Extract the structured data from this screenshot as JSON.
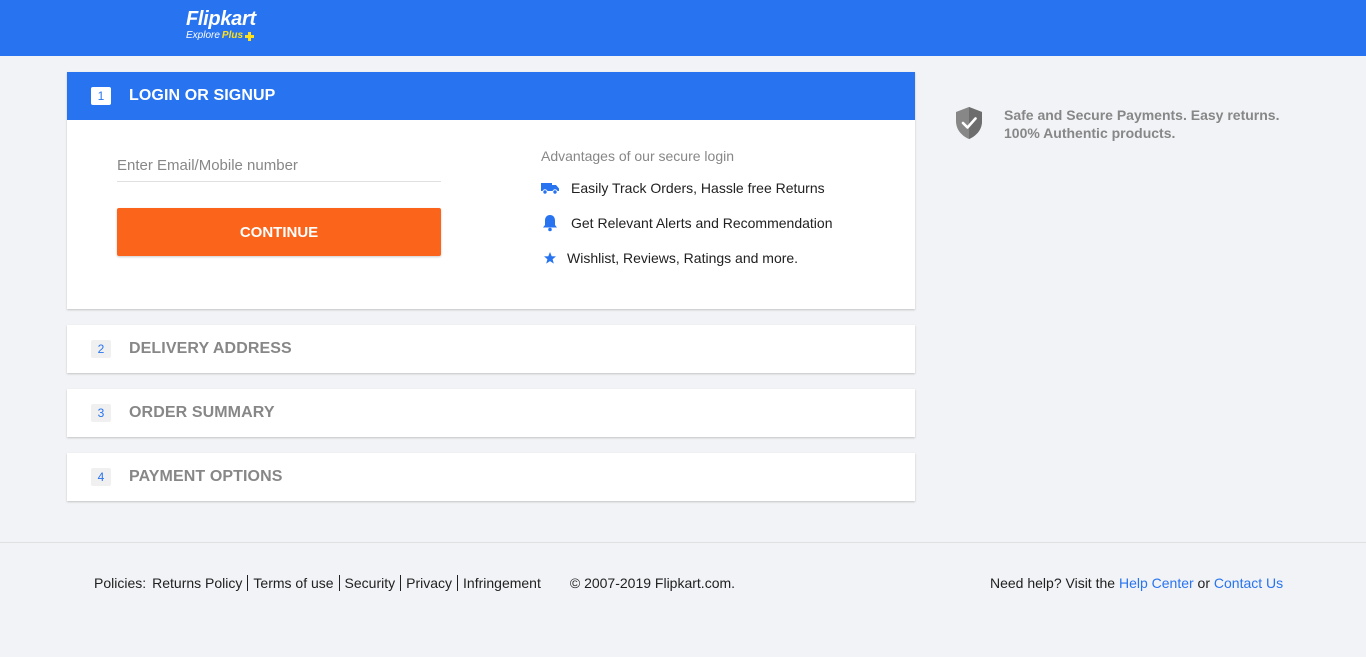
{
  "header": {
    "logo_text": "Flipkart",
    "logo_sub_prefix": "Explore",
    "logo_sub_plus": "Plus",
    "bg_color": "#2874f0"
  },
  "steps": [
    {
      "number": "1",
      "title": "LOGIN OR SIGNUP"
    },
    {
      "number": "2",
      "title": "DELIVERY ADDRESS"
    },
    {
      "number": "3",
      "title": "ORDER SUMMARY"
    },
    {
      "number": "4",
      "title": "PAYMENT OPTIONS"
    }
  ],
  "login": {
    "input_placeholder": "Enter Email/Mobile number",
    "input_value": "",
    "continue_label": "CONTINUE",
    "button_color": "#fb641b",
    "advantages_title": "Advantages of our secure login",
    "advantages": [
      {
        "icon": "truck-icon",
        "text": "Easily Track Orders, Hassle free Returns"
      },
      {
        "icon": "bell-icon",
        "text": "Get Relevant Alerts and Recommendation"
      },
      {
        "icon": "star-icon",
        "text": "Wishlist, Reviews, Ratings and more."
      }
    ]
  },
  "secure_note": {
    "icon": "shield-check-icon",
    "line1": "Safe and Secure Payments. Easy returns.",
    "line2": "100% Authentic products."
  },
  "footer": {
    "policies_label": "Policies:",
    "links": [
      "Returns Policy",
      "Terms of use",
      "Security",
      "Privacy",
      "Infringement"
    ],
    "copyright": "© 2007-2019 Flipkart.com.",
    "help_prefix": "Need help? Visit the",
    "help_center": "Help Center",
    "help_or": "or",
    "contact_us": "Contact Us"
  }
}
